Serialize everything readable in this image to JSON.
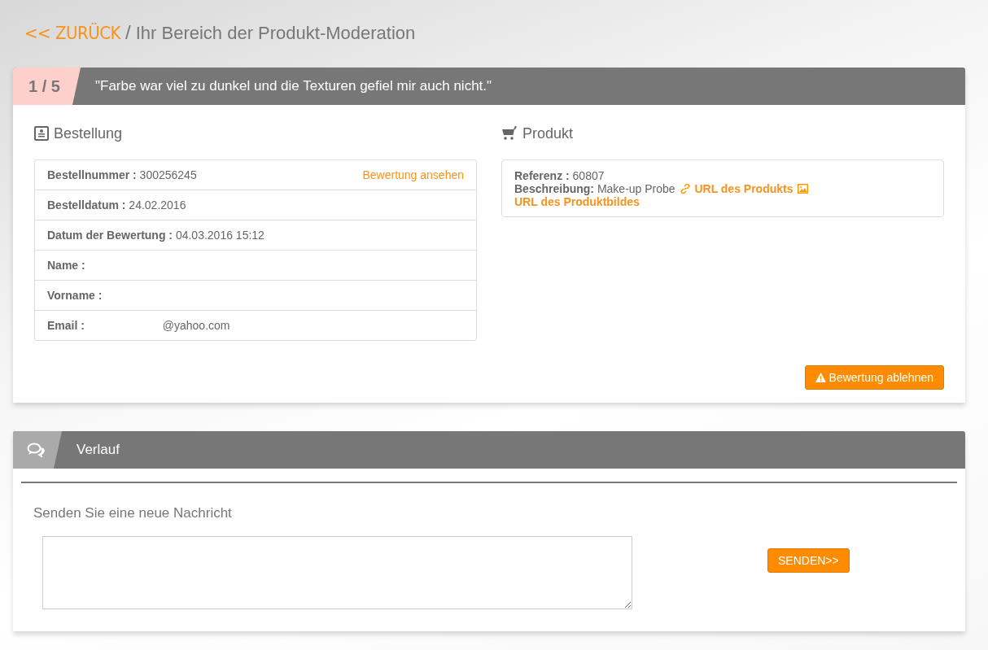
{
  "breadcrumb": {
    "back_link": "<< ZURÜCK",
    "separator": "/",
    "title": "Ihr Bereich der Produkt-Moderation"
  },
  "review": {
    "counter": "1 / 5",
    "quote": "\"Farbe war viel zu dunkel und die Texturen gefiel mir auch nicht.\""
  },
  "order": {
    "heading": "Bestellung",
    "view_link": "Bewertung ansehen",
    "fields": [
      {
        "label": "Bestellnummer :",
        "value": "300256245"
      },
      {
        "label": "Bestelldatum :",
        "value": "24.02.2016"
      },
      {
        "label": "Datum der Bewertung :",
        "value": "04.03.2016 15:12"
      },
      {
        "label": "Name :"
      },
      {
        "label": "Vorname :"
      },
      {
        "label": "Email :",
        "value": "@yahoo.com"
      }
    ]
  },
  "product": {
    "heading": "Produkt",
    "reference_label": "Referenz :",
    "reference": "60807",
    "description_label": "Beschreibung:",
    "description": "Make-up Probe",
    "product_url_link": "URL des Produkts",
    "image_url_link": "URL des Produktbildes"
  },
  "reject_button": "Bewertung ablehnen",
  "history": {
    "title": "Verlauf",
    "message_heading": "Senden Sie eine neue Nachricht",
    "send_button": "SENDEN>>"
  }
}
